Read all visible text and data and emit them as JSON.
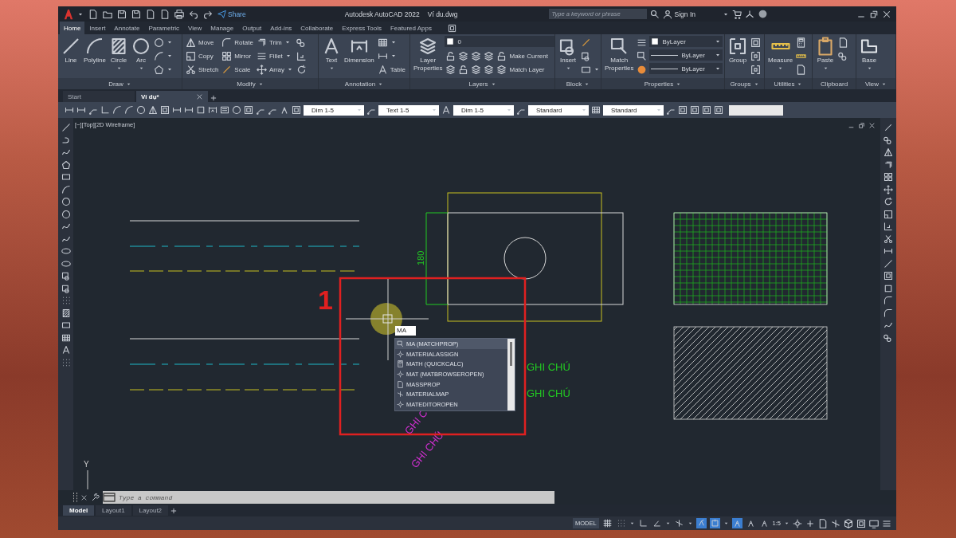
{
  "title_bar": {
    "share": "Share",
    "title": "Autodesk AutoCAD 2022",
    "file": "Ví du.dwg",
    "search": {
      "placeholder": "Type a keyword or phrase"
    },
    "sign_in": "Sign In"
  },
  "ribbon_tabs": [
    {
      "label": "Home",
      "selected": true
    },
    {
      "label": "Insert",
      "selected": false
    },
    {
      "label": "Annotate",
      "selected": false
    },
    {
      "label": "Parametric",
      "selected": false
    },
    {
      "label": "View",
      "selected": false
    },
    {
      "label": "Manage",
      "selected": false
    },
    {
      "label": "Output",
      "selected": false
    },
    {
      "label": "Add-ins",
      "selected": false
    },
    {
      "label": "Collaborate",
      "selected": false
    },
    {
      "label": "Express Tools",
      "selected": false
    },
    {
      "label": "Featured Apps",
      "selected": false
    }
  ],
  "ribbon_panels": [
    {
      "title": "Draw",
      "dropdown": true,
      "columns": [
        [
          {
            "kind": "large",
            "label": "Line"
          }
        ],
        [
          {
            "kind": "large",
            "label": "Polyline"
          }
        ],
        [
          {
            "kind": "large",
            "label": "Circle",
            "dropdown": true
          }
        ],
        [
          {
            "kind": "large",
            "label": "Arc",
            "dropdown": true
          }
        ],
        [
          {
            "kind": "small",
            "dropdown": true
          },
          {
            "kind": "small",
            "dropdown": true
          },
          {
            "kind": "small",
            "dropdown": true
          }
        ]
      ]
    },
    {
      "title": "Modify",
      "dropdown": true,
      "columns": [
        [
          {
            "kind": "small",
            "label": "Move"
          },
          {
            "kind": "small",
            "label": "Copy"
          },
          {
            "kind": "small",
            "label": "Stretch"
          }
        ],
        [
          {
            "kind": "small",
            "label": "Rotate"
          },
          {
            "kind": "small",
            "label": "Mirror"
          },
          {
            "kind": "small",
            "label": "Scale"
          }
        ],
        [
          {
            "kind": "small",
            "label": "Trim",
            "dropdown": true
          },
          {
            "kind": "small",
            "label": "Fillet",
            "dropdown": true
          },
          {
            "kind": "small",
            "label": "Array",
            "dropdown": true
          }
        ],
        [
          {
            "kind": "small"
          },
          {
            "kind": "small"
          },
          {
            "kind": "small"
          }
        ]
      ]
    },
    {
      "title": "Annotation",
      "dropdown": true,
      "columns": [
        [
          {
            "kind": "large",
            "label": "Text",
            "dropdown": true
          }
        ],
        [
          {
            "kind": "large",
            "label": "Dimension"
          }
        ],
        [
          {
            "kind": "small",
            "dropdown": true
          },
          {
            "kind": "small",
            "dropdown": true
          },
          {
            "kind": "small",
            "label": "Table"
          }
        ]
      ]
    },
    {
      "title": "Layers",
      "dropdown": true,
      "columns": [
        [
          {
            "kind": "large",
            "label": "Layer Properties"
          }
        ],
        [
          {
            "kind": "select",
            "value": "0"
          },
          {
            "kind": "row",
            "items": [
              {
                "kind": "small"
              },
              {
                "kind": "small"
              },
              {
                "kind": "small"
              },
              {
                "kind": "small"
              },
              {
                "kind": "small",
                "label": "Make Current"
              }
            ]
          },
          {
            "kind": "row",
            "items": [
              {
                "kind": "small"
              },
              {
                "kind": "small"
              },
              {
                "kind": "small"
              },
              {
                "kind": "small"
              },
              {
                "kind": "small",
                "label": "Match Layer"
              }
            ]
          }
        ]
      ]
    },
    {
      "title": "Block",
      "dropdown": true,
      "columns": [
        [
          {
            "kind": "large",
            "label": "Insert",
            "dropdown": true
          }
        ],
        [
          {
            "kind": "small"
          },
          {
            "kind": "small"
          },
          {
            "kind": "small",
            "dropdown": true
          }
        ]
      ]
    },
    {
      "title": "Properties",
      "dropdown": true,
      "columns": [
        [
          {
            "kind": "large",
            "label": "Match Properties"
          }
        ],
        [
          {
            "kind": "small"
          },
          {
            "kind": "small"
          },
          {
            "kind": "small"
          }
        ],
        [
          {
            "kind": "select",
            "value": "ByLayer"
          },
          {
            "kind": "line_select",
            "value": "ByLayer"
          },
          {
            "kind": "line_select",
            "value": "ByLayer"
          }
        ]
      ]
    },
    {
      "title": "Groups",
      "dropdown": true,
      "columns": [
        [
          {
            "kind": "large",
            "label": "Group"
          }
        ],
        [
          {
            "kind": "small"
          },
          {
            "kind": "small"
          },
          {
            "kind": "small"
          }
        ]
      ]
    },
    {
      "title": "Utilities",
      "dropdown": true,
      "columns": [
        [
          {
            "kind": "large",
            "label": "Measure",
            "dropdown": true
          }
        ],
        [
          {
            "kind": "small"
          },
          {
            "kind": "small"
          },
          {
            "kind": "small"
          }
        ]
      ]
    },
    {
      "title": "Clipboard",
      "dropdown": false,
      "columns": [
        [
          {
            "kind": "large",
            "label": "Paste",
            "dropdown": true
          }
        ],
        [
          {
            "kind": "small"
          },
          {
            "kind": "small"
          }
        ]
      ]
    },
    {
      "title": "View",
      "dropdown": true,
      "columns": [
        [
          {
            "kind": "large",
            "label": "Base",
            "dropdown": true
          }
        ]
      ]
    }
  ],
  "file_tabs": [
    {
      "label": "Start",
      "selected": false,
      "closable": false
    },
    {
      "label": "Ví dụ*",
      "selected": true,
      "closable": true
    }
  ],
  "style_toolbar": {
    "dropdowns": [
      {
        "value": "Dim 1-5"
      },
      {
        "value": "Text 1-5"
      },
      {
        "value": "Dim 1-5"
      },
      {
        "value": "Standard"
      },
      {
        "value": "Standard"
      }
    ]
  },
  "viewport": {
    "label": "[−][Top][2D Wireframe]",
    "ucs_label": "Y",
    "dimension": "180",
    "callout": "1",
    "command_input": "MA",
    "notes": [
      {
        "text": "GHI CHÚ",
        "kind": "horizontal"
      },
      {
        "text": "GHI CHÚ",
        "kind": "horizontal"
      },
      {
        "text": "GHI C",
        "kind": "rotated"
      },
      {
        "text": "GHI CHÚ",
        "kind": "rotated"
      }
    ],
    "suggestions": [
      {
        "label": "MA (MATCHPROP)",
        "selected": true
      },
      {
        "label": "MATERIALASSIGN",
        "selected": false
      },
      {
        "label": "MATH (QUICKCALC)",
        "selected": false
      },
      {
        "label": "MAT (MATBROWSEROPEN)",
        "selected": false
      },
      {
        "label": "MASSPROP",
        "selected": false
      },
      {
        "label": "MATERIALMAP",
        "selected": false
      },
      {
        "label": "MATEDITOROPEN",
        "selected": false
      }
    ]
  },
  "command_line": {
    "placeholder": "Type a command"
  },
  "layout_tabs": [
    {
      "label": "Model",
      "selected": true
    },
    {
      "label": "Layout1",
      "selected": false
    },
    {
      "label": "Layout2",
      "selected": false
    }
  ],
  "status_bar": {
    "mode": "MODEL",
    "toggles": [
      {
        "on": false
      },
      {
        "on": false
      },
      {
        "on": false
      },
      {
        "on": false
      },
      {
        "on": false
      },
      {
        "on": true
      },
      {
        "on": true
      },
      {
        "on": true
      },
      {
        "on": false
      },
      {
        "on": false
      }
    ],
    "scale": "1:5"
  }
}
